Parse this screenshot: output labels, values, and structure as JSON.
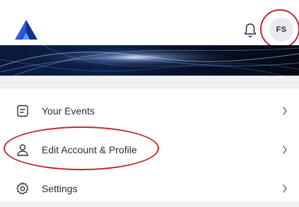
{
  "header": {
    "logo_icon": "app-logo-triangle",
    "notification_icon": "bell-icon",
    "avatar_initials": "FS"
  },
  "menu": {
    "items": [
      {
        "label": "Your Events",
        "icon": "event-list-icon"
      },
      {
        "label": "Edit Account & Profile",
        "icon": "user-icon"
      },
      {
        "label": "Settings",
        "icon": "gear-icon"
      }
    ]
  },
  "colors": {
    "accent_blue": "#1e5fd6",
    "annotation_red": "#c0262d",
    "banner_dark": "#08122a"
  }
}
